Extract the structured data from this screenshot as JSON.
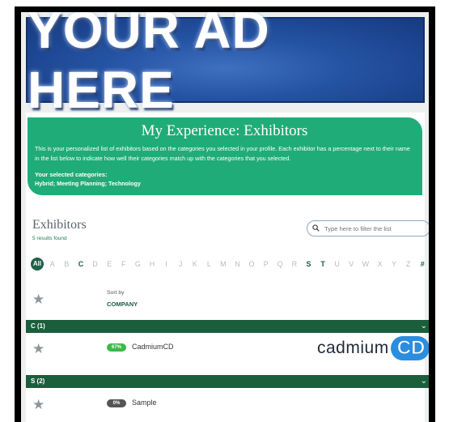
{
  "ad": {
    "text": "YOUR AD HERE"
  },
  "hero": {
    "title": "My Experience: Exhibitors",
    "description": "This is your personalized list of exhibitors based on the categories you selected in your profile. Each exhibitor has a percentage next to their name in the list below to indicate how well their categories match up with the categories that you selected.",
    "categories_label": "Your selected categories:",
    "categories_value": "Hybrid; Meeting Planning; Technology"
  },
  "exhibitors": {
    "title": "Exhibitors",
    "count": "5 results found",
    "search_placeholder": "Type here to filter the list"
  },
  "alphabet": {
    "all": "All",
    "letters": [
      "A",
      "B",
      "C",
      "D",
      "E",
      "F",
      "G",
      "H",
      "I",
      "J",
      "K",
      "L",
      "M",
      "N",
      "O",
      "P",
      "Q",
      "R",
      "S",
      "T",
      "U",
      "V",
      "W",
      "X",
      "Y",
      "Z",
      "#"
    ],
    "active": [
      "C",
      "S",
      "T",
      "#"
    ]
  },
  "sort": {
    "label": "Sort by",
    "value": "COMPANY"
  },
  "groups": [
    {
      "header": "C (1)",
      "items": [
        {
          "percent": "67%",
          "percent_value": 67,
          "name": "CadmiumCD",
          "logo": {
            "word": "cadmium",
            "mark": "CD"
          }
        }
      ]
    },
    {
      "header": "S (2)",
      "items": [
        {
          "percent": "0%",
          "percent_value": 0,
          "name": "Sample"
        }
      ]
    }
  ],
  "colors": {
    "hero_bg": "#1fac78",
    "group_bg": "#1b5e3c",
    "pct_high": "#3cb94a",
    "pct_zero": "#555555",
    "logo_blue": "#2b8de0"
  }
}
